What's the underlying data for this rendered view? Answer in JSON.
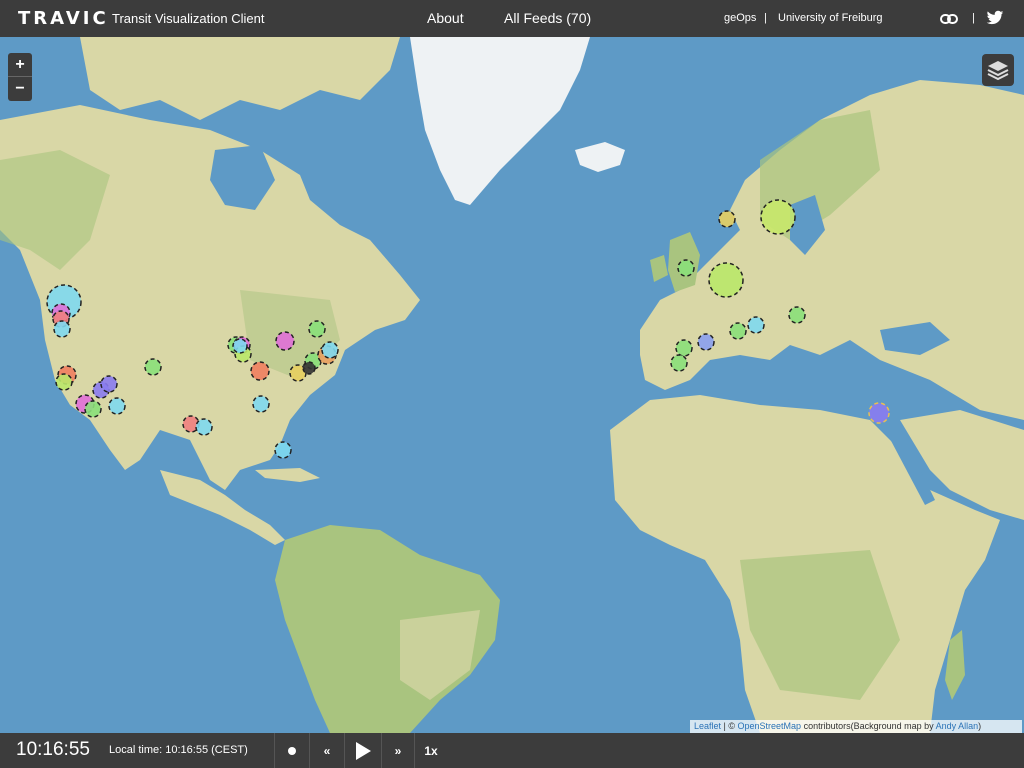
{
  "header": {
    "brand": "TRAVIC",
    "subtitle": "Transit Visualization Client",
    "nav_about": "About",
    "nav_feeds": "All Feeds (70)",
    "credit_geops": "geOps",
    "separator": "|",
    "credit_uni": "University of Freiburg",
    "link_icon": "link-icon",
    "twitter_icon": "twitter-icon"
  },
  "map": {
    "zoom_in": "+",
    "zoom_out": "−",
    "layers_icon": "layers-icon",
    "colors": {
      "ocean": "#5e9ac6",
      "land": "#d9d7a6",
      "land_green": "#a9c47f",
      "ice": "#eef2f4",
      "border": "#ffffff"
    }
  },
  "attribution": {
    "leaflet": "Leaflet",
    "sep": " | © ",
    "osm": "OpenStreetMap",
    "text": " contributors(Background map by ",
    "author": "Andy Allan",
    "close": ")"
  },
  "footer": {
    "clock": "10:16:55",
    "local_time": "Local time: 10:16:55 (CEST)",
    "record_icon": "record-icon",
    "rewind_label": "«",
    "play_icon": "play-icon",
    "forward_label": "»",
    "speed_label": "1x"
  }
}
